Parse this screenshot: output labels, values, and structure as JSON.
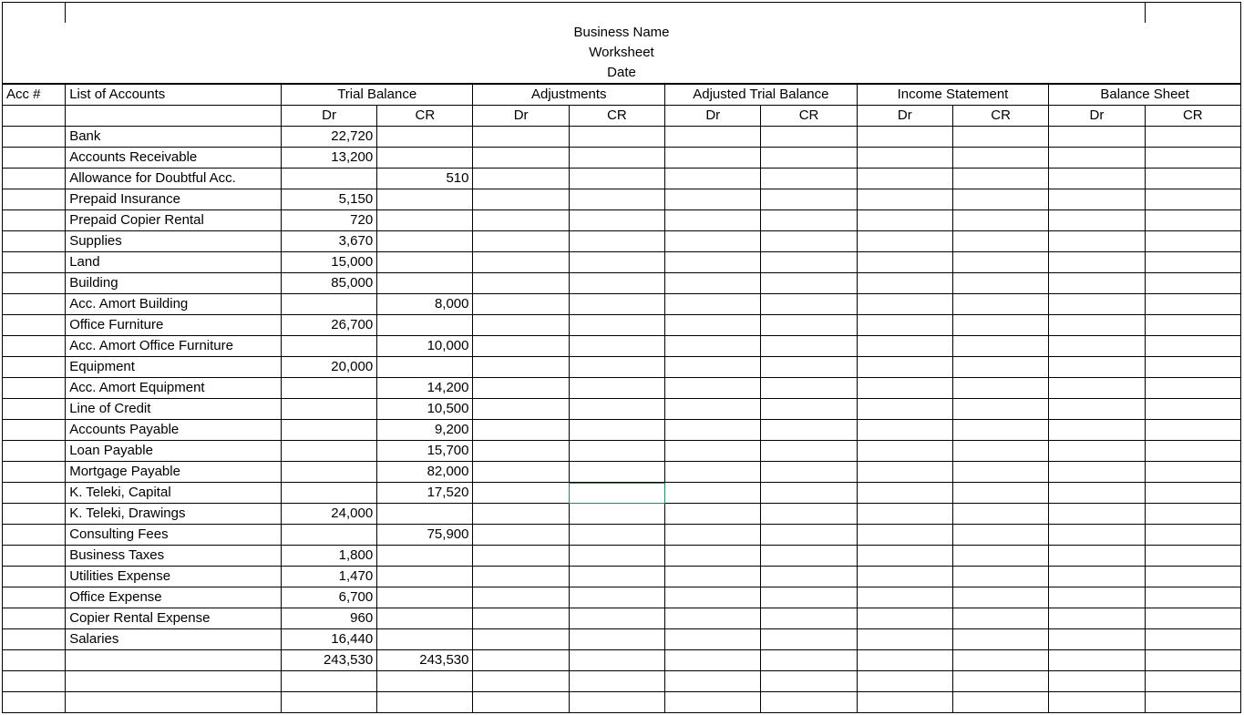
{
  "titles": {
    "business": "Business Name",
    "worksheet": "Worksheet",
    "date": "Date"
  },
  "headers": {
    "acc_no": "Acc #",
    "list_of_accounts": "List of Accounts",
    "groups": [
      "Trial Balance",
      "Adjustments",
      "Adjusted Trial Balance",
      "Income Statement",
      "Balance Sheet"
    ],
    "dr": "Dr",
    "cr": "CR"
  },
  "rows": [
    {
      "name": "Bank",
      "tb_dr": "22,720",
      "tb_cr": ""
    },
    {
      "name": "Accounts Receivable",
      "tb_dr": "13,200",
      "tb_cr": ""
    },
    {
      "name": "Allowance for Doubtful Acc.",
      "tb_dr": "",
      "tb_cr": "510"
    },
    {
      "name": "Prepaid Insurance",
      "tb_dr": "5,150",
      "tb_cr": ""
    },
    {
      "name": "Prepaid Copier Rental",
      "tb_dr": "720",
      "tb_cr": ""
    },
    {
      "name": "Supplies",
      "tb_dr": "3,670",
      "tb_cr": ""
    },
    {
      "name": "Land",
      "tb_dr": "15,000",
      "tb_cr": ""
    },
    {
      "name": "Building",
      "tb_dr": "85,000",
      "tb_cr": ""
    },
    {
      "name": "Acc. Amort Building",
      "tb_dr": "",
      "tb_cr": "8,000"
    },
    {
      "name": "Office Furniture",
      "tb_dr": "26,700",
      "tb_cr": ""
    },
    {
      "name": "Acc. Amort Office Furniture",
      "tb_dr": "",
      "tb_cr": "10,000"
    },
    {
      "name": "Equipment",
      "tb_dr": "20,000",
      "tb_cr": ""
    },
    {
      "name": "Acc. Amort Equipment",
      "tb_dr": "",
      "tb_cr": "14,200"
    },
    {
      "name": "Line of Credit",
      "tb_dr": "",
      "tb_cr": "10,500"
    },
    {
      "name": "Accounts Payable",
      "tb_dr": "",
      "tb_cr": "9,200"
    },
    {
      "name": "Loan Payable",
      "tb_dr": "",
      "tb_cr": "15,700"
    },
    {
      "name": "Mortgage Payable",
      "tb_dr": "",
      "tb_cr": "82,000"
    },
    {
      "name": "K. Teleki, Capital",
      "tb_dr": "",
      "tb_cr": "17,520"
    },
    {
      "name": "K. Teleki, Drawings",
      "tb_dr": "24,000",
      "tb_cr": ""
    },
    {
      "name": "Consulting Fees",
      "tb_dr": "",
      "tb_cr": "75,900"
    },
    {
      "name": "Business Taxes",
      "tb_dr": "1,800",
      "tb_cr": ""
    },
    {
      "name": "Utilities Expense",
      "tb_dr": "1,470",
      "tb_cr": ""
    },
    {
      "name": "Office Expense",
      "tb_dr": "6,700",
      "tb_cr": ""
    },
    {
      "name": "Copier Rental Expense",
      "tb_dr": "960",
      "tb_cr": ""
    },
    {
      "name": "Salaries",
      "tb_dr": "16,440",
      "tb_cr": ""
    }
  ],
  "totals": {
    "tb_dr": "243,530",
    "tb_cr": "243,530"
  },
  "selected_row_index": 17
}
